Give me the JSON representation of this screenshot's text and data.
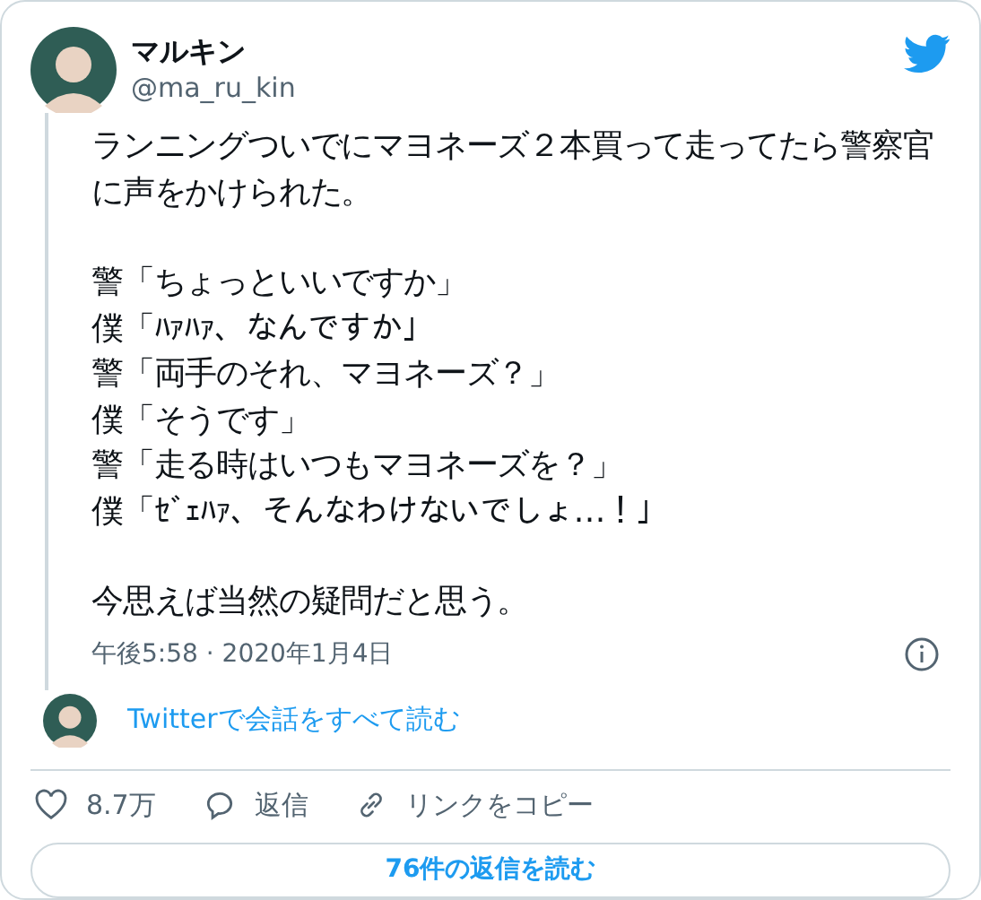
{
  "author": {
    "name": "マルキン",
    "handle": "@ma_ru_kin"
  },
  "paragraphs": [
    {
      "lines": [
        "ランニングついでにマヨネーズ２本買って走ってたら警察官に声をかけられた。"
      ]
    },
    {
      "lines": [
        "警「ちょっといいですか」",
        "僕「ﾊｧﾊｧ、なんですか」",
        "警「両手のそれ、マヨネーズ？」",
        "僕「そうです」",
        "警「走る時はいつもマヨネーズを？」",
        "僕「ｾﾞｪﾊｧ、そんなわけないでしょ…！」"
      ]
    },
    {
      "lines": [
        "今思えば当然の疑問だと思う。"
      ]
    }
  ],
  "timestamp": "午後5:58 · 2020年1月4日",
  "conversation_link": "Twitterで会話をすべて読む",
  "actions": [
    {
      "kind": "like",
      "label": "8.7万"
    },
    {
      "kind": "reply",
      "label": "返信"
    },
    {
      "kind": "copy",
      "label": "リンクをコピー"
    }
  ],
  "read_replies_button": "76件の返信を読む"
}
